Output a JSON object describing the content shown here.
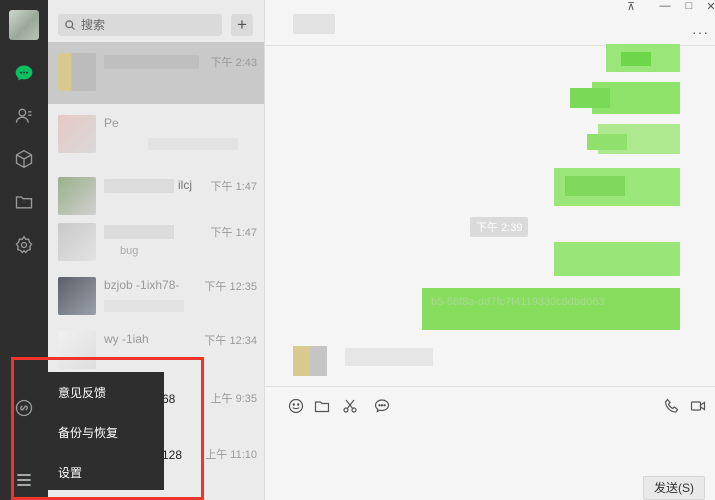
{
  "rail": {
    "icons": [
      "chat-icon",
      "contacts-icon",
      "cube-icon",
      "folder-icon",
      "mini-program-icon",
      "link-icon",
      "menu-icon"
    ],
    "active_color": "#07c160"
  },
  "search": {
    "placeholder": "搜索",
    "add_label": "+"
  },
  "conversations": [
    {
      "name": "",
      "preview": "",
      "time": "下午 2:43"
    },
    {
      "name": "Pe",
      "preview": "",
      "time": ""
    },
    {
      "name": "ilcj",
      "preview": "",
      "time": "下午 1:47"
    },
    {
      "name": "",
      "preview": "bug",
      "time": "下午 1:47"
    },
    {
      "name": "bzjob -1ixh78-",
      "preview": "",
      "time": "下午 12:35"
    },
    {
      "name": "wy -1iah",
      "preview": "",
      "time": "下午 12:34"
    },
    {
      "name": "68",
      "preview": "",
      "time": "上午 9:35"
    },
    {
      "name": "128",
      "preview": "",
      "time": "上午 11:10"
    }
  ],
  "chat": {
    "time_tag": "下午 2:39",
    "bubble_text": "b5-58f8a-dd7fc7f4119330c8dbd063",
    "send_label": "发送(S)",
    "more_label": "···",
    "window_controls": {
      "pin": "⊼",
      "min": "—",
      "max": "□",
      "close": "✕"
    }
  },
  "menu": {
    "items": [
      "意见反馈",
      "备份与恢复",
      "设置"
    ]
  },
  "colors": {
    "bubble_green": "#95ec69",
    "highlight_red": "#f0342c"
  }
}
